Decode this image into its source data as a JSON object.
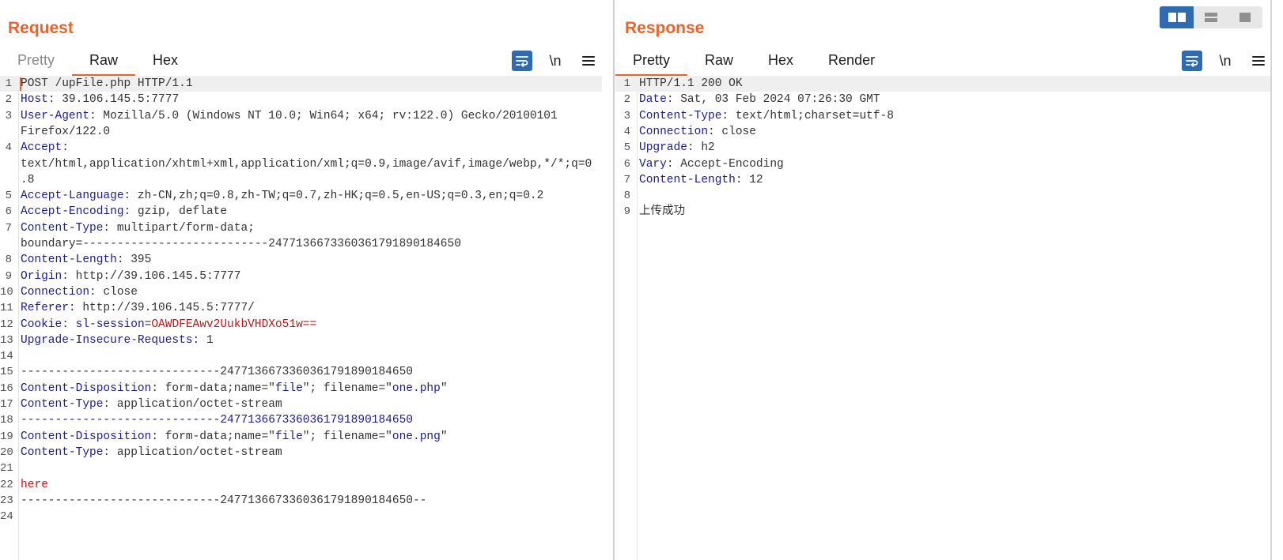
{
  "colors": {
    "accent": "#e8642c",
    "header_name": "#1b1b8f",
    "value": "#333333",
    "string": "#1b1b8f",
    "red": "#b21b1b",
    "toolbar_blue": "#2f6bb0"
  },
  "view_toggle": {
    "options": [
      {
        "icon": "split-horizontal-icon",
        "active": true
      },
      {
        "icon": "split-vertical-icon",
        "active": false
      },
      {
        "icon": "single-pane-icon",
        "active": false
      }
    ]
  },
  "request": {
    "title": "Request",
    "tabs": [
      {
        "label": "Pretty",
        "active": false,
        "disabled": true
      },
      {
        "label": "Raw",
        "active": true,
        "disabled": false
      },
      {
        "label": "Hex",
        "active": false,
        "disabled": false
      }
    ],
    "tools": {
      "wrap_icon": "wrap-lines-icon",
      "newline_label": "\\n",
      "menu_icon": "hamburger-menu-icon"
    },
    "lines": [
      {
        "n": "1",
        "segs": [
          [
            "POST /upFile.php HTTP/1.1",
            "v"
          ]
        ]
      },
      {
        "n": "2",
        "segs": [
          [
            "Host",
            "h"
          ],
          [
            ": 39.106.145.5:7777",
            "v"
          ]
        ]
      },
      {
        "n": "3",
        "segs": [
          [
            "User-Agent",
            "h"
          ],
          [
            ": Mozilla/5.0 (Windows NT 10.0; Win64; x64; rv:122.0) Gecko/20100101",
            "v"
          ]
        ]
      },
      {
        "n": null,
        "segs": [
          [
            "Firefox/122.0",
            "v"
          ]
        ]
      },
      {
        "n": "4",
        "segs": [
          [
            "Accept",
            "h"
          ],
          [
            ":",
            "v"
          ]
        ]
      },
      {
        "n": null,
        "segs": [
          [
            "text/html,application/xhtml+xml,application/xml;q=0.9,image/avif,image/webp,*/*;q=0",
            "v"
          ]
        ]
      },
      {
        "n": null,
        "segs": [
          [
            ".8",
            "v"
          ]
        ]
      },
      {
        "n": "5",
        "segs": [
          [
            "Accept-Language",
            "h"
          ],
          [
            ": zh-CN,zh;q=0.8,zh-TW;q=0.7,zh-HK;q=0.5,en-US;q=0.3,en;q=0.2",
            "v"
          ]
        ]
      },
      {
        "n": "6",
        "segs": [
          [
            "Accept-Encoding",
            "h"
          ],
          [
            ": gzip, deflate",
            "v"
          ]
        ]
      },
      {
        "n": "7",
        "segs": [
          [
            "Content-Type",
            "h"
          ],
          [
            ": multipart/form-data;",
            "v"
          ]
        ]
      },
      {
        "n": null,
        "segs": [
          [
            "boundary=---------------------------247713667336036179189018465​0",
            "v"
          ]
        ]
      },
      {
        "n": "8",
        "segs": [
          [
            "Content-Length",
            "h"
          ],
          [
            ": 395",
            "v"
          ]
        ]
      },
      {
        "n": "9",
        "segs": [
          [
            "Origin",
            "h"
          ],
          [
            ": http://39.106.145.5:7777",
            "v"
          ]
        ]
      },
      {
        "n": "10",
        "segs": [
          [
            "Connection",
            "h"
          ],
          [
            ": close",
            "v"
          ]
        ]
      },
      {
        "n": "11",
        "segs": [
          [
            "Referer",
            "h"
          ],
          [
            ": http://39.106.145.5:7777/",
            "v"
          ]
        ]
      },
      {
        "n": "12",
        "segs": [
          [
            "Cookie",
            "h"
          ],
          [
            ": ",
            "v"
          ],
          [
            "sl-session",
            "h"
          ],
          [
            "=",
            "v"
          ],
          [
            "OAWDFEAwv2UukbVHDXo51w==",
            "r"
          ]
        ]
      },
      {
        "n": "13",
        "segs": [
          [
            "Upgrade-Insecure-Requests",
            "h"
          ],
          [
            ": 1",
            "v"
          ]
        ]
      },
      {
        "n": "14",
        "segs": []
      },
      {
        "n": "15",
        "segs": [
          [
            "-----------------------------247713667336036179189018465​0",
            "v"
          ]
        ]
      },
      {
        "n": "16",
        "segs": [
          [
            "Content-Disposition",
            "h"
          ],
          [
            ": form-data;name=\"",
            "v"
          ],
          [
            "file",
            "s"
          ],
          [
            "\"; filename=\"",
            "v"
          ],
          [
            "one.php",
            "s"
          ],
          [
            "\"",
            "v"
          ]
        ]
      },
      {
        "n": "17",
        "segs": [
          [
            "Content-Type",
            "h"
          ],
          [
            ": application/octet-stream",
            "v"
          ]
        ]
      },
      {
        "n": "18",
        "segs": [
          [
            "-----------------------------247713667336036179189018465​0",
            "s"
          ]
        ]
      },
      {
        "n": "19",
        "segs": [
          [
            "Content-Disposition",
            "h"
          ],
          [
            ": form-data;name=\"",
            "v"
          ],
          [
            "file",
            "s"
          ],
          [
            "\"; filename=\"",
            "v"
          ],
          [
            "one.png",
            "s"
          ],
          [
            "\"",
            "v"
          ]
        ]
      },
      {
        "n": "20",
        "segs": [
          [
            "Content-Type",
            "h"
          ],
          [
            ": application/octet-stream",
            "v"
          ]
        ]
      },
      {
        "n": "21",
        "segs": []
      },
      {
        "n": "22",
        "segs": [
          [
            "here",
            "r"
          ]
        ]
      },
      {
        "n": "23",
        "segs": [
          [
            "-----------------------------247713667336036179189018465​0--",
            "v"
          ]
        ]
      },
      {
        "n": "24",
        "segs": []
      }
    ]
  },
  "response": {
    "title": "Response",
    "tabs": [
      {
        "label": "Pretty",
        "active": true,
        "disabled": false
      },
      {
        "label": "Raw",
        "active": false,
        "disabled": false
      },
      {
        "label": "Hex",
        "active": false,
        "disabled": false
      },
      {
        "label": "Render",
        "active": false,
        "disabled": false
      }
    ],
    "tools": {
      "wrap_icon": "wrap-lines-icon",
      "newline_label": "\\n",
      "menu_icon": "hamburger-menu-icon"
    },
    "lines": [
      {
        "n": "1",
        "segs": [
          [
            "HTTP/1.1 200 OK",
            "v"
          ]
        ]
      },
      {
        "n": "2",
        "segs": [
          [
            "Date",
            "h"
          ],
          [
            ": Sat, 03 Feb 2024 07:26:30 GMT",
            "v"
          ]
        ]
      },
      {
        "n": "3",
        "segs": [
          [
            "Content-Type",
            "h"
          ],
          [
            ": text/html;charset=utf-8",
            "v"
          ]
        ]
      },
      {
        "n": "4",
        "segs": [
          [
            "Connection",
            "h"
          ],
          [
            ": close",
            "v"
          ]
        ]
      },
      {
        "n": "5",
        "segs": [
          [
            "Upgrade",
            "h"
          ],
          [
            ": h2",
            "v"
          ]
        ]
      },
      {
        "n": "6",
        "segs": [
          [
            "Vary",
            "h"
          ],
          [
            ": Accept-Encoding",
            "v"
          ]
        ]
      },
      {
        "n": "7",
        "segs": [
          [
            "Content-Length",
            "h"
          ],
          [
            ": 12",
            "v"
          ]
        ]
      },
      {
        "n": "8",
        "segs": []
      },
      {
        "n": "9",
        "segs": [
          [
            "上传成功",
            "v"
          ]
        ]
      }
    ]
  }
}
